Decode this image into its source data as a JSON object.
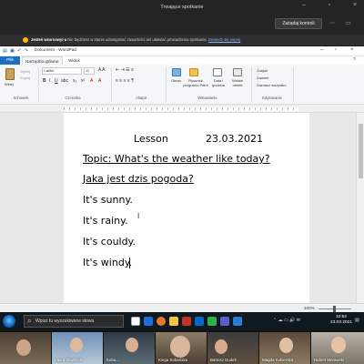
{
  "meeting": {
    "title": "Trwające spotkanie",
    "control_button": "Zażądaj kontroli",
    "notice_bold": "Jesteś wzorcowy/-a",
    "notice_text": "Nie będziesz w stanie udostępniać zawartości ani ułatwiać prowadzenia spotkania.",
    "notice_link": "Dowiedz się więcej"
  },
  "wordpad": {
    "title": "Dokument - WordPad",
    "tabs": [
      "Plik",
      "Narzędzia główne",
      "Widok"
    ],
    "ribbon": {
      "paste": "Wklej",
      "cut": "Wytnij",
      "copy": "Kopiuj",
      "clipboard_group": "Schowek",
      "font_name": "Calibri",
      "font_size": "11",
      "font_group": "Czcionka",
      "paragraph_group": "Akapit",
      "picture": "Obraz",
      "paint": "Rysunek programu Paint",
      "datetime": "Data i godzina",
      "object": "Wstaw obiekt",
      "insert_group": "Wstawianie",
      "find": "Znajdź",
      "replace": "Zamień",
      "select_all": "Zaznacz wszystko",
      "edit_group": "Edytowanie"
    },
    "document": {
      "line1_left": "Lesson",
      "line1_right": "23.03.2021",
      "line2": "Topic: What's the weather like today?",
      "line3": "Jaka jest dzis pogoda?",
      "line4": "It's sunny.",
      "line5": "It's rainy.",
      "line6": "It's couldy.",
      "line7": "It's windy."
    },
    "zoom_label": "100%"
  },
  "taskbar": {
    "search_placeholder": "Wpisz tu wyszukiwane słowa",
    "time": "10:52",
    "date": "23.03.2021"
  },
  "participants": [
    {
      "name": ""
    },
    {
      "name": "Laura Słowiński"
    },
    {
      "name": "Kuba..."
    },
    {
      "name": "Kinga Sobańska"
    },
    {
      "name": "Bartosz Dudek"
    },
    {
      "name": "Magda Kobierska"
    },
    {
      "name": "Hubert Morawski"
    }
  ]
}
